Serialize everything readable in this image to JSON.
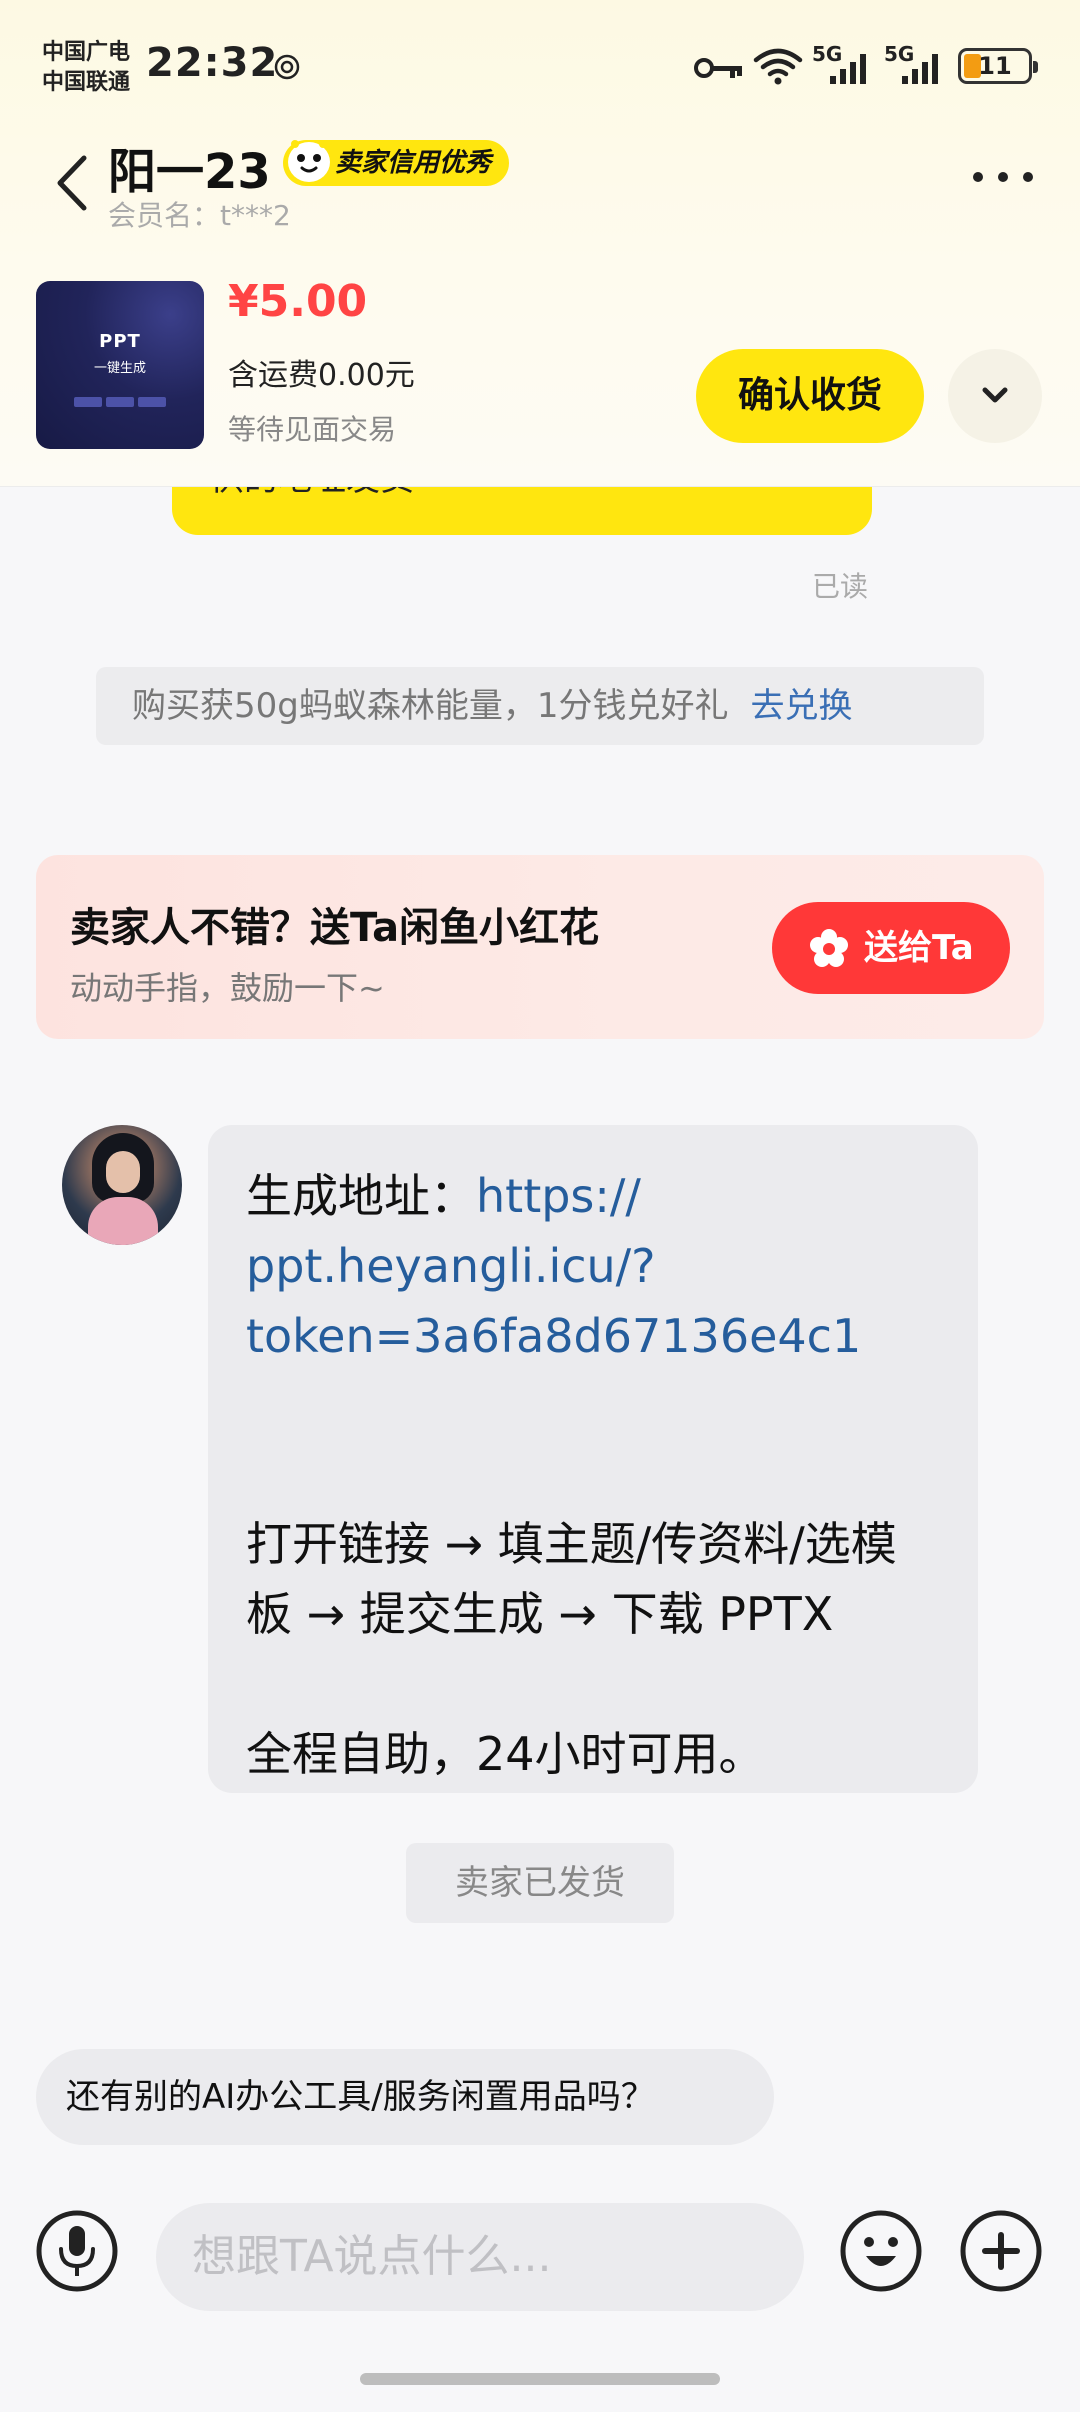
{
  "status_bar": {
    "carrier_1": "中国广电",
    "carrier_2": "中国联通",
    "time": "22:32",
    "net_1": "5G",
    "net_2": "5G",
    "battery": "11"
  },
  "header": {
    "seller_name": "阳一23",
    "credit_badge": "卖家信用优秀",
    "member_label": "会员名：t***2"
  },
  "product": {
    "thumb_title": "PPT",
    "thumb_sub": "一键生成",
    "price": "¥5.00",
    "shipping": "含运费0.00元",
    "trade_status": "等待见面交易",
    "confirm_label": "确认收货"
  },
  "chat": {
    "prev_bubble_text": "供的地址发货",
    "read_label": "已读",
    "promo_text": "购买获50g蚂蚁森林能量，1分钱兑好礼",
    "promo_link": "去兑换",
    "flower_title": "卖家人不错？送Ta闲鱼小红花",
    "flower_sub": "动动手指，鼓励一下~",
    "give_label": "送给Ta",
    "message": {
      "url_prefix": "生成地址：",
      "url_line1": "https://",
      "url_line2": "ppt.heyangli.icu/?",
      "url_line3": "token=3a6fa8d67136e4c1",
      "steps_line1": "打开链接 → 填主题/传资料/选模",
      "steps_line2": "板 → 提交生成 → 下载 PPTX",
      "note": "全程自助，24小时可用。"
    },
    "shipped_label": "卖家已发货",
    "quick_question": "还有别的AI办公工具/服务闲置用品吗？"
  },
  "input": {
    "placeholder": "想跟TA说点什么..."
  },
  "colors": {
    "accent_yellow": "#ffe60f",
    "price_red": "#ff4444",
    "give_red": "#ff3838",
    "link_blue": "#255d9c"
  }
}
